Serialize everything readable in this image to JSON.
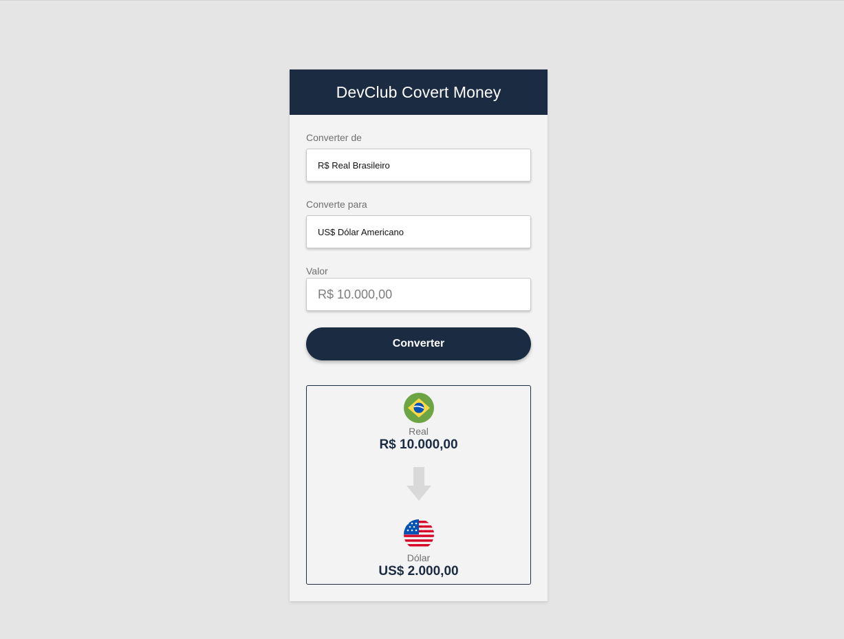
{
  "app": {
    "title": "DevClub Covert Money"
  },
  "form": {
    "from_label": "Converter de",
    "from_selected": "R$ Real Brasileiro",
    "to_label": "Converte para",
    "to_selected": "US$ Dólar Americano",
    "value_label": "Valor",
    "value_placeholder": "R$ 10.000,00",
    "convert_button": "Converter"
  },
  "result": {
    "from": {
      "name": "Real",
      "value": "R$ 10.000,00",
      "flag_icon": "brazil-flag-icon"
    },
    "arrow_icon": "arrow-down-icon",
    "to": {
      "name": "Dólar",
      "value": "US$ 2.000,00",
      "flag_icon": "usa-flag-icon"
    }
  },
  "colors": {
    "primary": "#1a2b42",
    "background": "#e5e5e5",
    "card": "#f3f3f3"
  }
}
